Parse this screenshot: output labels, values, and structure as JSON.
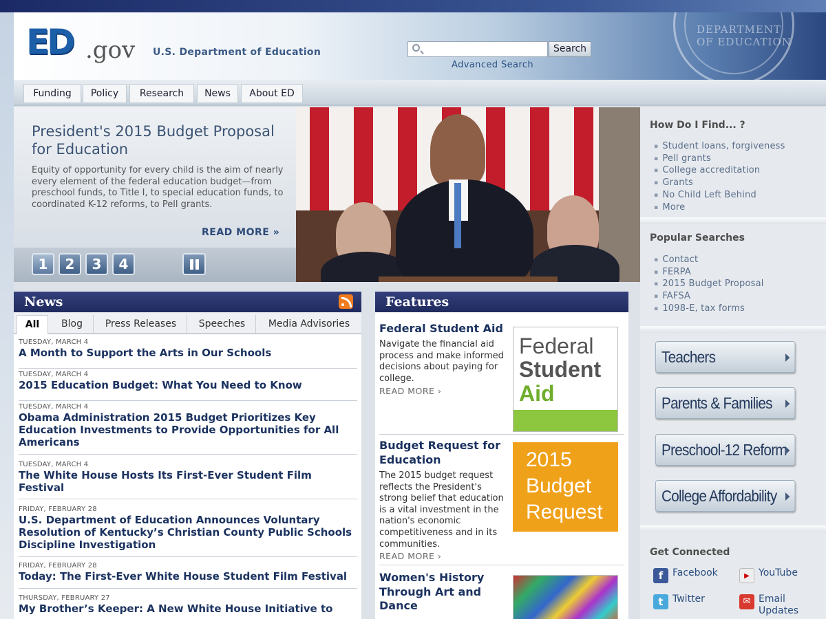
{
  "header": {
    "logo_ed": "ED",
    "logo_gov": ".gov",
    "dept_name": "U.S. Department of Education",
    "search_placeholder": "",
    "search_button": "Search",
    "advanced_search": "Advanced Search",
    "seal_text": "DEPARTMENT OF EDUCATION"
  },
  "nav": [
    "Funding",
    "Policy",
    "Research",
    "News",
    "About ED"
  ],
  "hero": {
    "title": "President's 2015 Budget Proposal for Education",
    "body": "Equity of opportunity for every child is the aim of nearly every element of the federal education budget—from preschool funds, to Title I, to special education funds, to coordinated K-12 reforms, to Pell grants.",
    "read_more": "READ MORE »",
    "slides": [
      "1",
      "2",
      "3",
      "4"
    ]
  },
  "news": {
    "heading": "News",
    "tabs": [
      "All",
      "Blog",
      "Press Releases",
      "Speeches",
      "Media Advisories"
    ],
    "items": [
      {
        "date": "TUESDAY, MARCH 4",
        "title": "A Month to Support the Arts in Our Schools"
      },
      {
        "date": "TUESDAY, MARCH 4",
        "title": "2015 Education Budget: What You Need to Know"
      },
      {
        "date": "TUESDAY, MARCH 4",
        "title": "Obama Administration 2015 Budget Prioritizes Key Education Investments to Provide Opportunities for All Americans"
      },
      {
        "date": "TUESDAY, MARCH 4",
        "title": "The White House Hosts Its First-Ever Student Film Festival"
      },
      {
        "date": "FRIDAY, FEBRUARY 28",
        "title": "U.S. Department of Education Announces Voluntary Resolution of Kentucky’s Christian County Public Schools Discipline Investigation"
      },
      {
        "date": "FRIDAY, FEBRUARY 28",
        "title": "Today: The First-Ever White House Student Film Festival"
      },
      {
        "date": "THURSDAY, FEBRUARY 27",
        "title": "My Brother’s Keeper: A New White House Initiative to"
      }
    ]
  },
  "features": {
    "heading": "Features",
    "items": [
      {
        "title": "Federal Student Aid",
        "body": "Navigate the financial aid process and make informed decisions about paying for college.",
        "more": "READ MORE ›",
        "image_text": [
          "Federal",
          "Student",
          "Aid"
        ]
      },
      {
        "title": "Budget Request for Education",
        "body": "The 2015 budget request reflects the President's strong belief that education is a vital investment in the nation's economic competitiveness and in its communities.",
        "more": "READ MORE ›",
        "image_text": [
          "2015",
          "Budget",
          "Request"
        ]
      },
      {
        "title": "Women's History Through Art and Dance",
        "body": "",
        "more": "",
        "image_text": []
      }
    ]
  },
  "sidebar": {
    "find_heading": "How Do I Find... ?",
    "find_items": [
      "Student loans, forgiveness",
      "Pell grants",
      "College accreditation",
      "Grants",
      "No Child Left Behind",
      "More"
    ],
    "popular_heading": "Popular Searches",
    "popular_items": [
      "Contact",
      "FERPA",
      "2015 Budget Proposal",
      "FAFSA",
      "1098-E, tax forms"
    ],
    "audience_buttons": [
      "Teachers",
      "Parents & Families",
      "Preschool-12 Reform",
      "College Affordability"
    ],
    "connected_heading": "Get Connected",
    "social": {
      "facebook": "Facebook",
      "youtube": "YouTube",
      "twitter": "Twitter",
      "email": "Email Updates"
    }
  },
  "colors": {
    "nav_dark": "#1f2a5e",
    "link": "#1c3360",
    "fsa_green": "#8dc63f",
    "budget_orange": "#f0a11a"
  }
}
